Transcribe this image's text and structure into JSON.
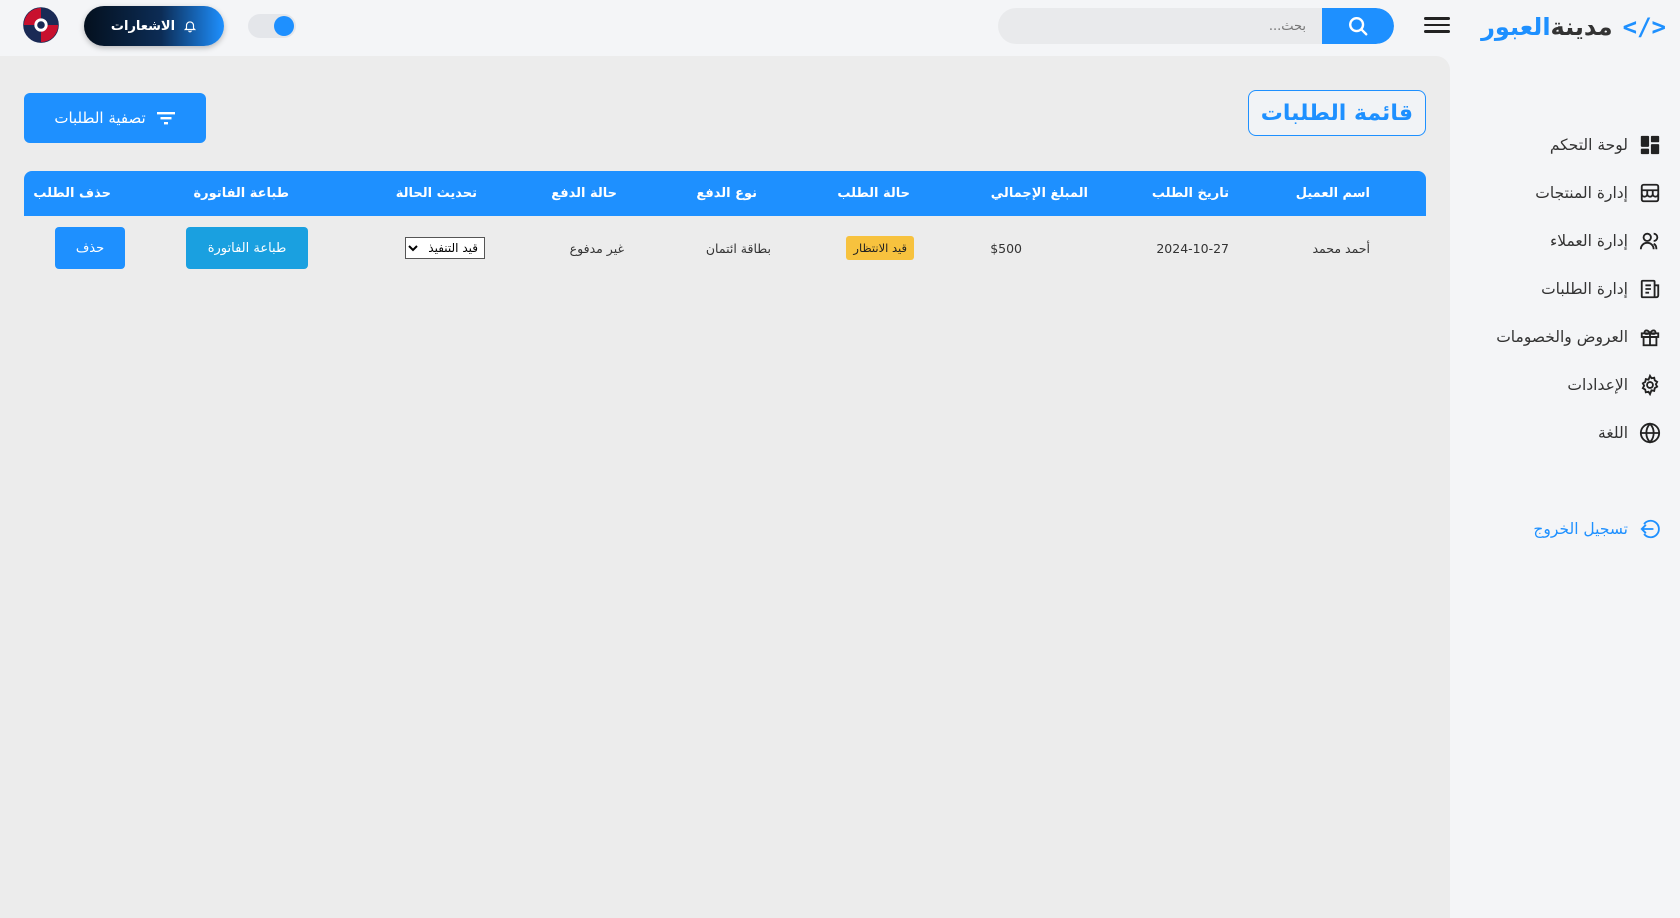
{
  "brand": {
    "code_symbol": "</>",
    "name_main": "مدينة",
    "name_accent": "العبور",
    "accent_color": "#1e90ff"
  },
  "header": {
    "search_placeholder": "بحث...",
    "notifications_label": "الاشعارات"
  },
  "sidebar": {
    "items": [
      {
        "label": "لوحة التحكم",
        "icon": "dashboard-icon"
      },
      {
        "label": "إدارة المنتجات",
        "icon": "store-icon"
      },
      {
        "label": "إدارة العملاء",
        "icon": "users-icon"
      },
      {
        "label": "إدارة الطلبات",
        "icon": "orders-icon"
      },
      {
        "label": "العروض والخصومات",
        "icon": "gift-icon"
      },
      {
        "label": "الإعدادات",
        "icon": "gear-icon"
      },
      {
        "label": "اللغة",
        "icon": "globe-icon"
      }
    ],
    "logout_label": "تسجيل الخروج"
  },
  "main": {
    "title": "قائمة الطلبات",
    "filter_label": "تصفية الطلبات",
    "table": {
      "headers": [
        "اسم العميل",
        "تاريخ الطلب",
        "المبلغ الإجمالي",
        "حالة الطلب",
        "نوع الدفع",
        "حالة الدفع",
        "تحديث الحالة",
        "طباعة الفاتورة",
        "حذف الطلب"
      ],
      "rows": [
        {
          "customer": "أحمد محمد",
          "date": "2024-10-27",
          "total": "$500",
          "status": "قيد الانتظار",
          "payment_type": "بطاقة ائتمان",
          "payment_status": "غير مدفوع",
          "update_status_value": "قيد التنفيذ",
          "print_label": "طباعة الفاتورة",
          "delete_label": "حذف"
        }
      ]
    }
  },
  "colors": {
    "primary": "#1e90ff",
    "pending_badge": "#f7c23e",
    "background": "#ececec"
  }
}
